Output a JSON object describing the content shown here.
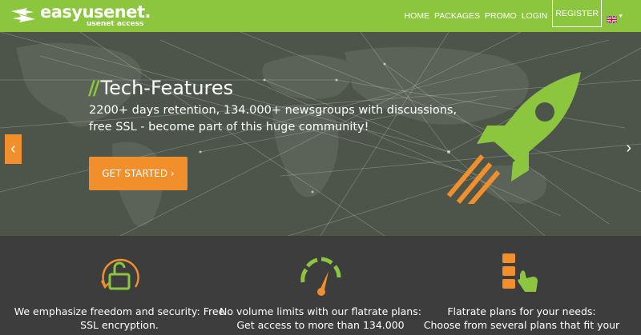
{
  "brand": {
    "name": "easyusenet.",
    "tagline": "usenet access"
  },
  "nav": {
    "items": [
      "HOME",
      "PACKAGES",
      "PROMO",
      "LOGIN",
      "REGISTER"
    ],
    "language": "english-flag"
  },
  "hero": {
    "title": "Tech-Features",
    "subtitle_line1": "2200+ days retention, 134.000+ newsgroups with discussions,",
    "subtitle_line2": "free SSL - become part of this huge community!",
    "cta": "GET STARTED ›",
    "prev_icon": "chevron-left-icon",
    "next_icon": "chevron-right-icon"
  },
  "features": [
    {
      "icon": "open-lock-icon",
      "line1": "We emphasize freedom and security: Free",
      "line2": "SSL encryption."
    },
    {
      "icon": "speedometer-icon",
      "line1": "No volume limits with our flatrate plans:",
      "line2": "Get access to more than 134.000"
    },
    {
      "icon": "plan-select-icon",
      "line1": "Flatrate plans for your needs:",
      "line2": "Choose from several plans that fit your"
    }
  ],
  "colors": {
    "brand_green": "#8cc63f",
    "accent_orange": "#f18f2c",
    "dark_bg": "#3d3d3d"
  }
}
